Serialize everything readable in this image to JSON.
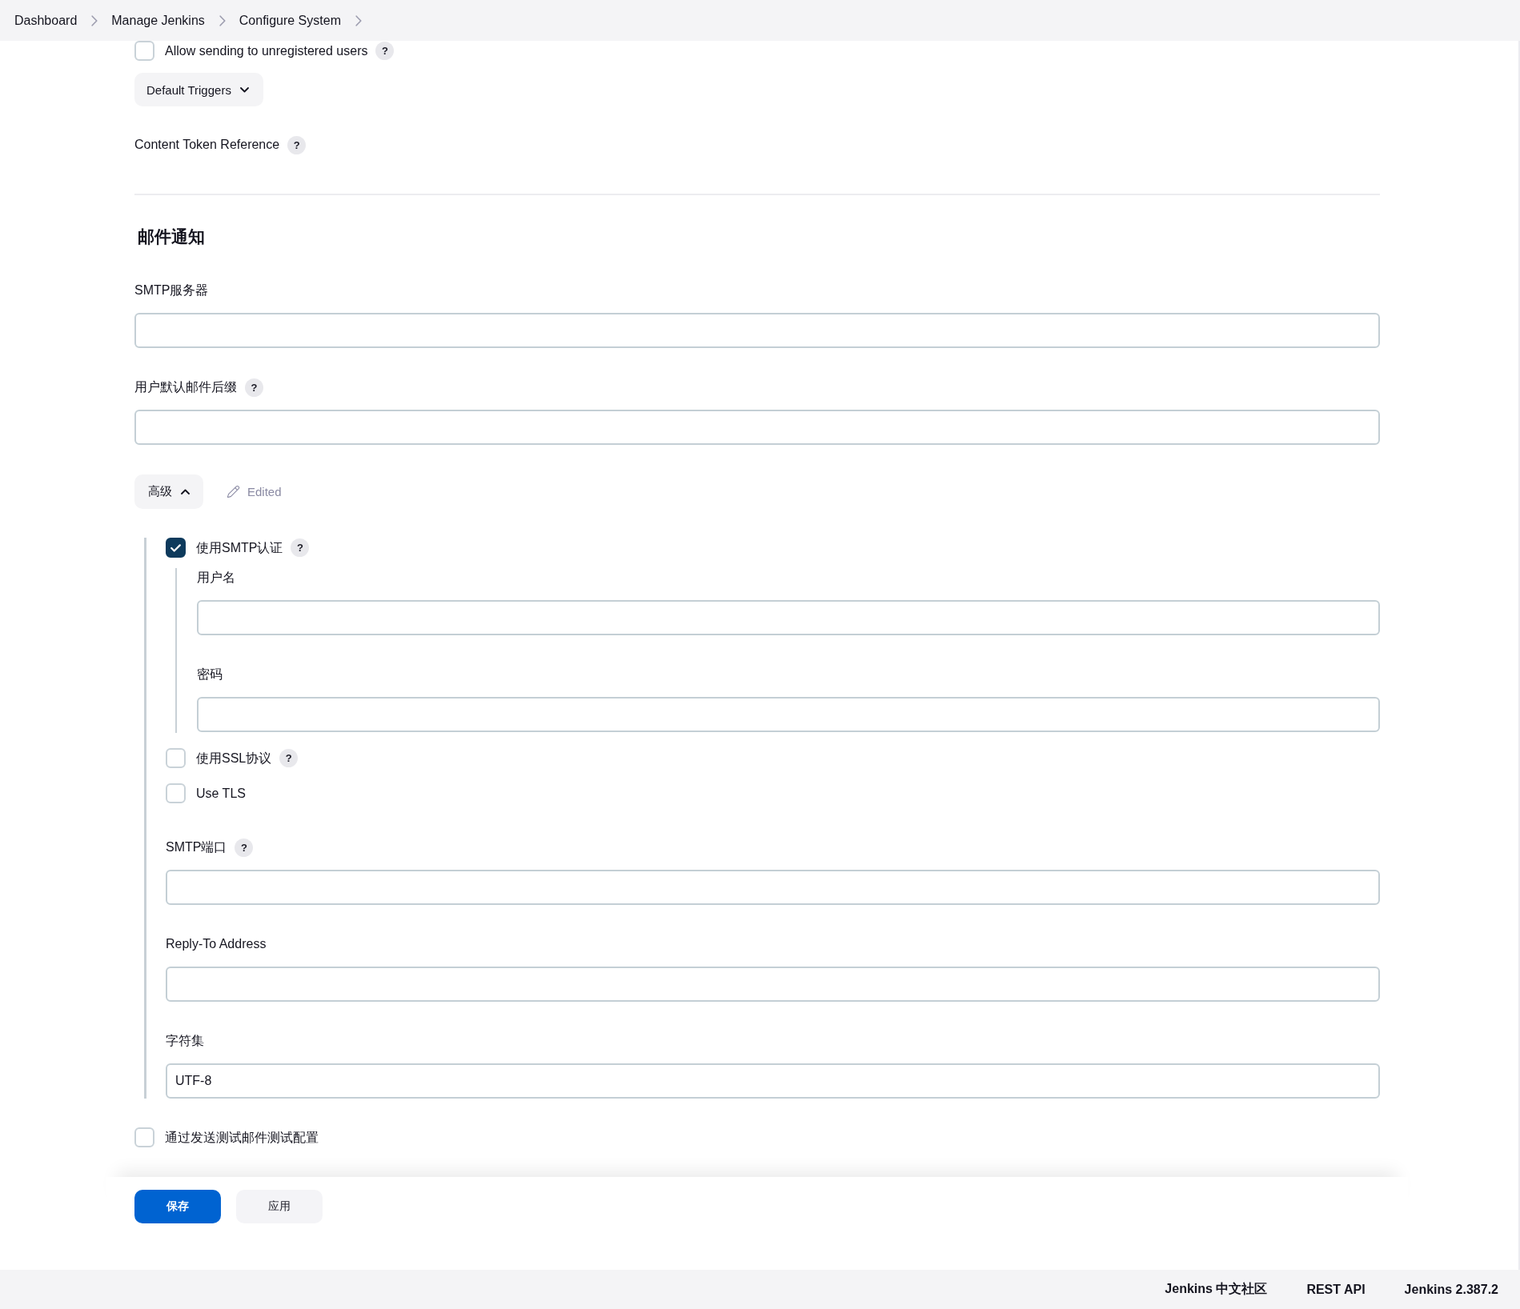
{
  "breadcrumbs": [
    {
      "label": "Dashboard"
    },
    {
      "label": "Manage Jenkins"
    },
    {
      "label": "Configure System"
    }
  ],
  "top_items": [
    {
      "kind": "checkbox",
      "label": "Allow sending to unregistered users",
      "checked": false,
      "help": "?"
    },
    {
      "kind": "dropdown",
      "label": "Default Triggers",
      "expanded": false
    },
    {
      "kind": "label",
      "label": "Content Token Reference",
      "help": "?"
    }
  ],
  "mail_section": {
    "title": "邮件通知",
    "fields": [
      {
        "kind": "text",
        "label": "SMTP服务器"
      },
      {
        "kind": "text",
        "label": "用户默认邮件后缀",
        "help": "?"
      }
    ],
    "advanced": {
      "label": "高级",
      "expanded": true,
      "edited": "Edited",
      "items": [
        {
          "kind": "checkbox",
          "label": "使用SMTP认证",
          "checked": true,
          "help": "?",
          "children": [
            {
              "kind": "text",
              "label": "用户名"
            },
            {
              "kind": "text",
              "label": "密码"
            }
          ]
        },
        {
          "kind": "checkbox",
          "label": "使用SSL协议",
          "checked": false,
          "help": "?"
        },
        {
          "kind": "checkbox",
          "label": "Use TLS",
          "checked": false
        },
        {
          "kind": "text",
          "label": "SMTP端口",
          "help": "?"
        },
        {
          "kind": "text",
          "label": "Reply-To Address"
        },
        {
          "kind": "text",
          "label": "字符集",
          "value": "UTF-8"
        }
      ]
    },
    "test": {
      "kind": "checkbox",
      "label": "通过发送测试邮件测试配置",
      "checked": false
    }
  },
  "buttons": [
    {
      "label": "保存",
      "kind": "primary"
    },
    {
      "label": "应用",
      "kind": "secondary"
    }
  ],
  "footer": {
    "links": [
      "Jenkins 中文社区",
      "REST API",
      "Jenkins 2.387.2"
    ]
  }
}
